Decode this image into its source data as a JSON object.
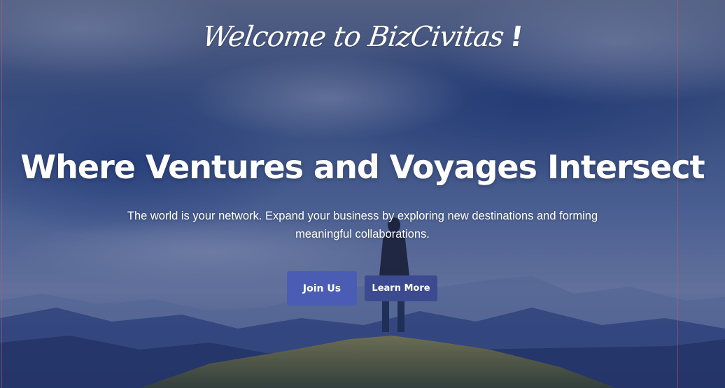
{
  "hero": {
    "welcome_text": "Welcome to BizCivitas",
    "welcome_punct": "!",
    "headline": "Where Ventures and Voyages Intersect",
    "subtext": "The world is your network. Expand your business by exploring new destinations and forming meaningful collaborations.",
    "background_image": "mountain-hiker-landscape"
  },
  "buttons": {
    "join_label": "Join Us",
    "learn_label": "Learn More"
  },
  "colors": {
    "join_button": "#4a5cb3",
    "learn_button": "#3c4a8f",
    "text": "#ffffff",
    "sky_overlay": "#2c3f7a"
  }
}
